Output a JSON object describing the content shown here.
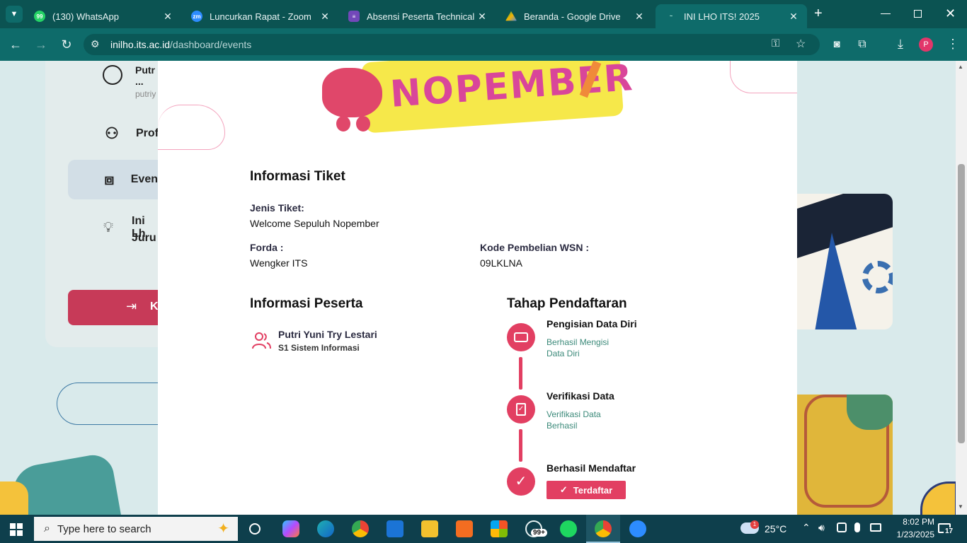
{
  "browser": {
    "tabs": [
      {
        "title": "(130) WhatsApp",
        "icon": "whatsapp-icon",
        "color": "#25d366"
      },
      {
        "title": "Luncurkan Rapat - Zoom",
        "icon": "zoom-icon",
        "color": "#2d8cff"
      },
      {
        "title": "Absensi Peserta Technical M",
        "icon": "forms-icon",
        "color": "#7248b9"
      },
      {
        "title": "Beranda - Google Drive",
        "icon": "drive-icon",
        "color": "#f4b400"
      },
      {
        "title": "INI LHO ITS! 2025",
        "icon": "inilho-icon",
        "color": "#ffffff"
      }
    ],
    "url_domain": "inilho.its.ac.id",
    "url_path": "/dashboard/events",
    "profile_initial": "P"
  },
  "sidebar": {
    "user_name": "Putr",
    "user_name_more": "...",
    "user_sub": "putriy",
    "items": [
      {
        "label": "Prof",
        "icon": "user-icon"
      },
      {
        "label": "Even",
        "icon": "events-icon"
      },
      {
        "label_line1": "Ini Lh",
        "label_line2": "Juru",
        "icon": "lightbulb-icon"
      }
    ],
    "logout_label": "K"
  },
  "modal": {
    "banner_text": "NOPEMBER",
    "ticket_heading": "Informasi Tiket",
    "jenis_label": "Jenis Tiket:",
    "jenis_value": "Welcome Sepuluh Nopember",
    "forda_label": "Forda :",
    "forda_value": "Wengker ITS",
    "kode_label": "Kode Pembelian WSN :",
    "kode_value": "09LKLNA",
    "peserta_heading": "Informasi Peserta",
    "peserta_name": "Putri Yuni Try Lestari",
    "peserta_major": "S1 Sistem Informasi",
    "tahap_heading": "Tahap Pendaftaran",
    "steps": [
      {
        "title": "Pengisian Data Diri",
        "subtitle": "Berhasil Mengisi Data Diri",
        "icon": "id-card-icon"
      },
      {
        "title": "Verifikasi Data",
        "subtitle": "Verifikasi Data Berhasil",
        "icon": "clipboard-check-icon"
      },
      {
        "title": "Berhasil Mendaftar",
        "badge": "Terdaftar",
        "icon": "check-icon"
      }
    ],
    "accent_color": "#e23f62"
  },
  "taskbar": {
    "search_placeholder": "Type here to search",
    "weather": "25°C",
    "weather_badge": "1",
    "time": "8:02 PM",
    "date": "1/23/2025",
    "whatsapp_badge": "99+",
    "notification_count": "17"
  }
}
